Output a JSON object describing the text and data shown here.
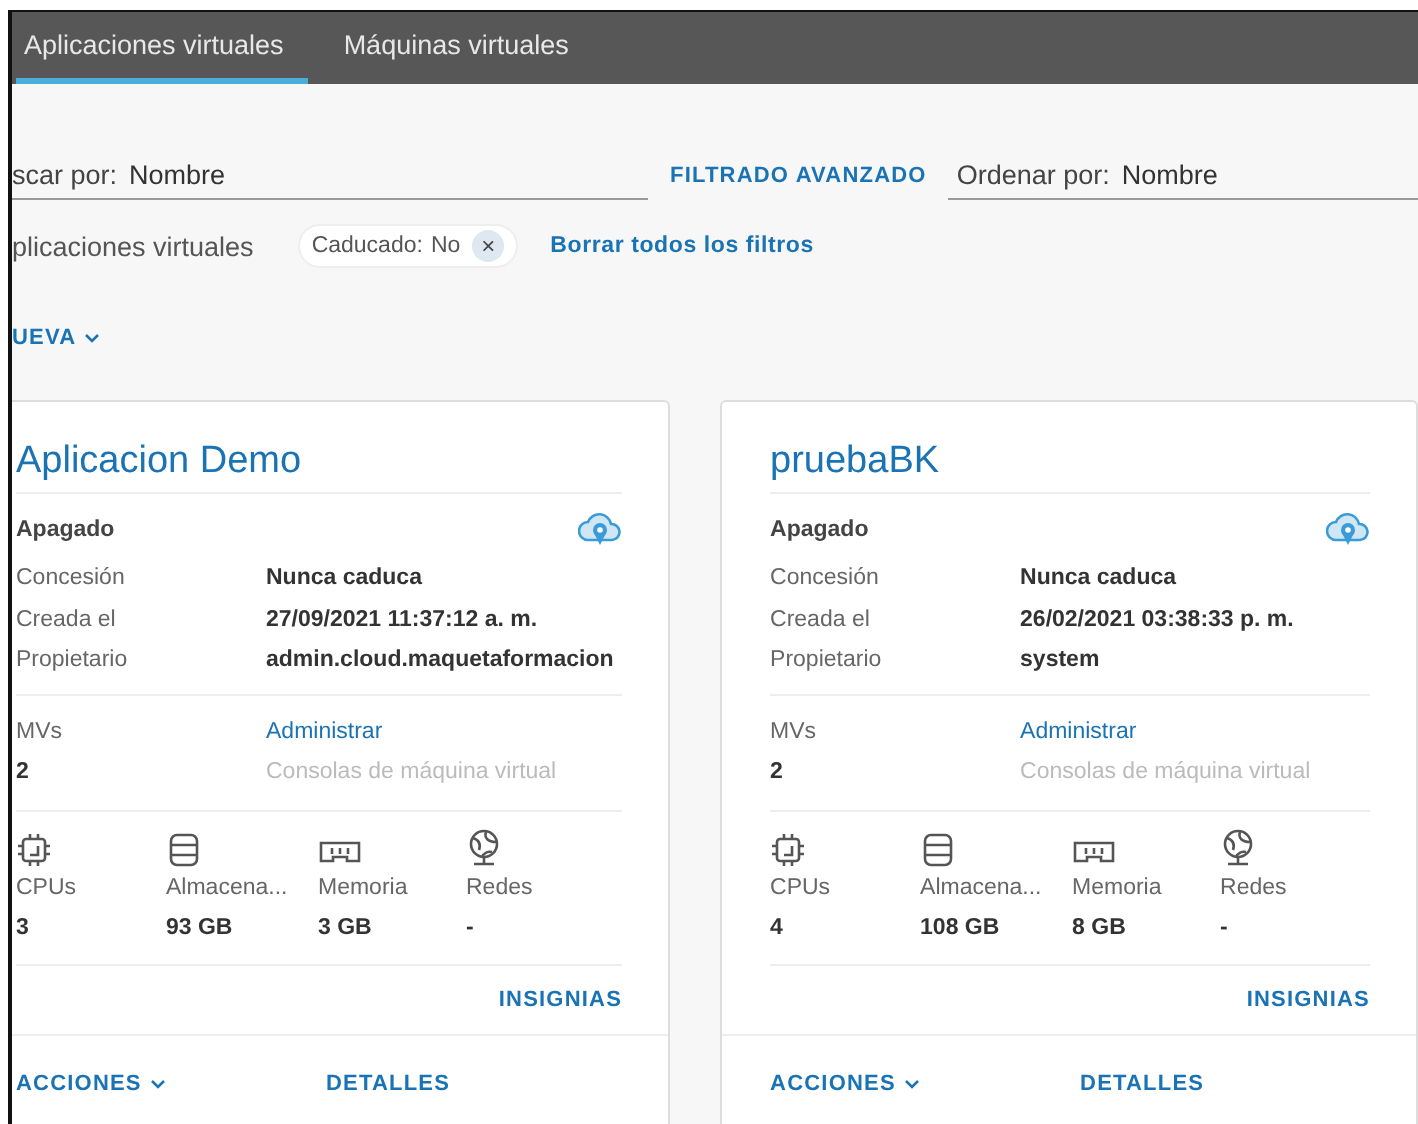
{
  "tabs": [
    {
      "label": "Aplicaciones virtuales",
      "selected": true
    },
    {
      "label": "Máquinas virtuales",
      "selected": false
    }
  ],
  "search": {
    "label": "scar por:",
    "value": "Nombre"
  },
  "advanced_filter": "FILTRADO AVANZADO",
  "sort": {
    "label": "Ordenar por:",
    "value": "Nombre"
  },
  "filters": {
    "label": "plicaciones virtuales",
    "chips": [
      {
        "label": "Caducado:",
        "value": "No",
        "remove": "×"
      }
    ],
    "clear": "Borrar todos los filtros"
  },
  "new_button": "UEVA",
  "cards": [
    {
      "title": "Aplicacion Demo",
      "status": "Apagado",
      "details": [
        {
          "label": "Concesión",
          "value": "Nunca caduca"
        },
        {
          "label": "Creada el",
          "value": "27/09/2021 11:37:12 a. m."
        },
        {
          "label": "Propietario",
          "value": "admin.cloud.maquetaformacion"
        }
      ],
      "vms": {
        "label": "MVs",
        "value": "2",
        "manage": "Administrar",
        "consoles": "Consolas de máquina virtual",
        "consoles_disabled": true
      },
      "resources": [
        {
          "kind": "cpu",
          "label": "CPUs",
          "value": "3"
        },
        {
          "kind": "storage",
          "label": "Almacena...",
          "value": "93 GB"
        },
        {
          "kind": "memory",
          "label": "Memoria",
          "value": "3 GB"
        },
        {
          "kind": "network",
          "label": "Redes",
          "value": "-"
        }
      ],
      "badges": "INSIGNIAS",
      "actions": "ACCIONES",
      "details_link": "DETALLES"
    },
    {
      "title": "pruebaBK",
      "status": "Apagado",
      "details": [
        {
          "label": "Concesión",
          "value": "Nunca caduca"
        },
        {
          "label": "Creada el",
          "value": "26/02/2021 03:38:33 p. m."
        },
        {
          "label": "Propietario",
          "value": "system"
        }
      ],
      "vms": {
        "label": "MVs",
        "value": "2",
        "manage": "Administrar",
        "consoles": "Consolas de máquina virtual",
        "consoles_disabled": true
      },
      "resources": [
        {
          "kind": "cpu",
          "label": "CPUs",
          "value": "4"
        },
        {
          "kind": "storage",
          "label": "Almacena...",
          "value": "108 GB"
        },
        {
          "kind": "memory",
          "label": "Memoria",
          "value": "8 GB"
        },
        {
          "kind": "network",
          "label": "Redes",
          "value": "-"
        }
      ],
      "badges": "INSIGNIAS",
      "actions": "ACCIONES",
      "details_link": "DETALLES"
    }
  ]
}
